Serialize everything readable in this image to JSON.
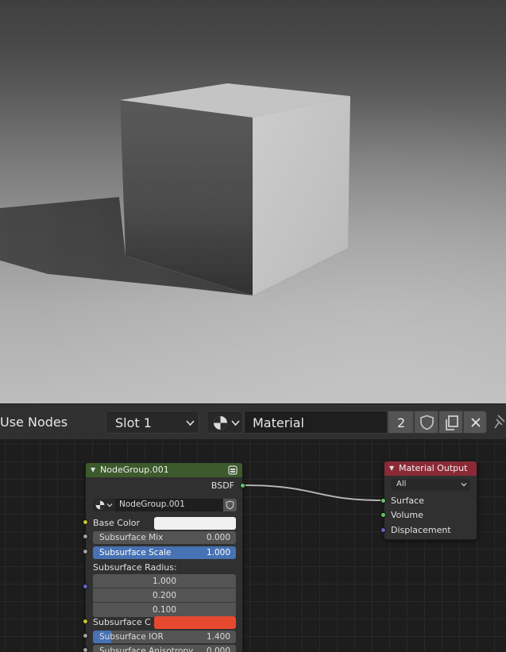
{
  "header": {
    "use_nodes_label": "Use Nodes",
    "slot_label": "Slot 1",
    "material_name": "Material",
    "user_count": "2"
  },
  "node_group": {
    "title": "NodeGroup.001",
    "output_socket": "BSDF",
    "datablock_name": "NodeGroup.001",
    "header_color": "#3c5a2b",
    "inputs": {
      "base_color_label": "Base Color",
      "base_color_value": "#f0f0f0",
      "subsurface_mix_label": "Subsurface Mix",
      "subsurface_mix_value": "0.000",
      "subsurface_scale_label": "Subsurface Scale",
      "subsurface_scale_value": "1.000",
      "subsurface_radius_label": "Subsurface Radius:",
      "subsurface_radius": [
        "1.000",
        "0.200",
        "0.100"
      ],
      "subsurface_color_label": "Subsurface C",
      "subsurface_color_value": "#e6492f",
      "subsurface_ior_label": "Subsurface IOR",
      "subsurface_ior_value": "1.400",
      "subsurface_anisotropy_label": "Subsurface Anisotropy",
      "subsurface_anisotropy_value": "0.000"
    }
  },
  "material_output": {
    "title": "Material Output",
    "header_color": "#8a2a36",
    "target_value": "All",
    "inputs": [
      "Surface",
      "Volume",
      "Displacement"
    ]
  },
  "colors": {
    "accent_blue": "#4772b3",
    "socket_shader": "#63c763",
    "socket_color": "#c7c729",
    "socket_float": "#a1a1a1",
    "socket_vector": "#6363c7"
  },
  "icons": [
    "material-sphere-icon",
    "chevron-down-icon",
    "fake-user-shield-icon",
    "duplicate-icon",
    "close-icon",
    "pin-icon",
    "node-group-icon"
  ]
}
